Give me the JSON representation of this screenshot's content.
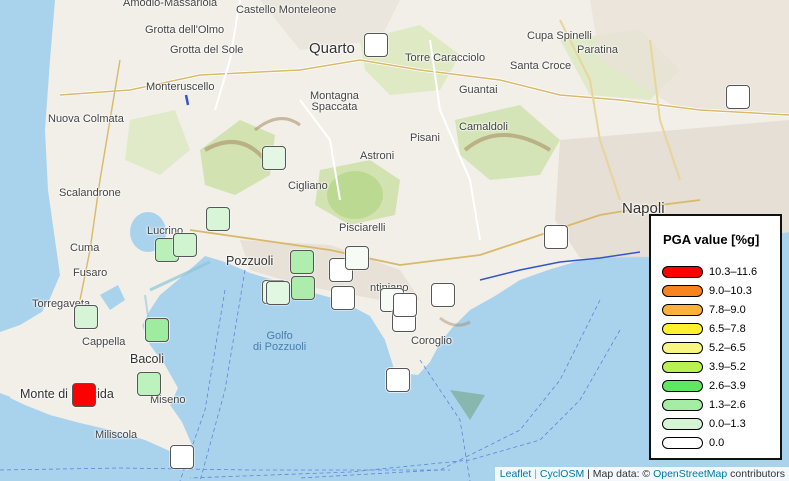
{
  "map": {
    "places": [
      {
        "id": "amodio",
        "label": "Amodio-Massariola"
      },
      {
        "id": "castello",
        "label": "Castello Monteleone"
      },
      {
        "id": "grotta-olmo",
        "label": "Grotta dell'Olmo"
      },
      {
        "id": "grotta-sole",
        "label": "Grotta del Sole"
      },
      {
        "id": "quarto",
        "label": "Quarto"
      },
      {
        "id": "torre-caracciolo",
        "label": "Torre Caracciolo"
      },
      {
        "id": "cupa-spinelli",
        "label": "Cupa Spinelli"
      },
      {
        "id": "paratina",
        "label": "Paratina"
      },
      {
        "id": "santa-croce",
        "label": "Santa Croce"
      },
      {
        "id": "monteruscello",
        "label": "Monteruscello"
      },
      {
        "id": "nuova-colmata",
        "label": "Nuova Colmata"
      },
      {
        "id": "guantai",
        "label": "Guantai"
      },
      {
        "id": "montagna-spaccata",
        "label": "Montagna\nSpaccata"
      },
      {
        "id": "camaldoli",
        "label": "Camaldoli"
      },
      {
        "id": "pisani",
        "label": "Pisani"
      },
      {
        "id": "astroni",
        "label": "Astroni"
      },
      {
        "id": "cigliano",
        "label": "Cigliano"
      },
      {
        "id": "scalandrone",
        "label": "Scalandrone"
      },
      {
        "id": "napoli",
        "label": "Napoli"
      },
      {
        "id": "lucrino",
        "label": "Lucrino"
      },
      {
        "id": "pisciarelli",
        "label": "Pisciarelli"
      },
      {
        "id": "cuma",
        "label": "Cuma"
      },
      {
        "id": "fusaro",
        "label": "Fusaro"
      },
      {
        "id": "pozzuoli",
        "label": "Pozzuoli"
      },
      {
        "id": "torregaveta",
        "label": "Torregaveta"
      },
      {
        "id": "cappella",
        "label": "Cappella"
      },
      {
        "id": "bacoli",
        "label": "Bacoli"
      },
      {
        "id": "coroglio",
        "label": "Coroglio"
      },
      {
        "id": "monte-procida",
        "label": "Monte di Procida"
      },
      {
        "id": "miseno",
        "label": "Miseno"
      },
      {
        "id": "miliscola",
        "label": "Miliscola"
      },
      {
        "id": "agnano",
        "label": "ntiniano"
      }
    ],
    "sea_label": "Golfo\ndi Pozzuoli"
  },
  "markers": [
    {
      "pga_class": "0.0",
      "color": "#ffffff"
    },
    {
      "pga_class": "0.0",
      "color": "#ffffff"
    },
    {
      "pga_class": "0.0–1.3",
      "color": "#e4f7e4"
    },
    {
      "pga_class": "0.0–1.3",
      "color": "#d8f5d8"
    },
    {
      "pga_class": "1.3–2.6",
      "color": "#b8f0b8"
    },
    {
      "pga_class": "0.0–1.3",
      "color": "#d0f3d0"
    },
    {
      "pga_class": "1.3–2.6",
      "color": "#b0eeb0"
    },
    {
      "pga_class": "1.3–2.6",
      "color": "#acedac"
    },
    {
      "pga_class": "0.0",
      "color": "#ffffff"
    },
    {
      "pga_class": "1.3–2.6",
      "color": "#b2efb2"
    },
    {
      "pga_class": "0.0",
      "color": "#ffffff"
    },
    {
      "pga_class": "0.0",
      "color": "#f6fbf6"
    },
    {
      "pga_class": "0.0–1.3",
      "color": "#e6f8e6"
    },
    {
      "pga_class": "0.0",
      "color": "#ffffff"
    },
    {
      "pga_class": "0.0–1.3",
      "color": "#e2f7e2"
    },
    {
      "pga_class": "1.3–2.6",
      "color": "#c4f2c4"
    },
    {
      "pga_class": "0.0",
      "color": "#f6fbf6"
    },
    {
      "pga_class": "0.0",
      "color": "#ffffff"
    },
    {
      "pga_class": "0.0",
      "color": "#ffffff"
    },
    {
      "pga_class": "0.0",
      "color": "#ffffff"
    },
    {
      "pga_class": "0.0",
      "color": "#ffffff"
    },
    {
      "pga_class": "0.0–1.3",
      "color": "#d6f4d6"
    },
    {
      "pga_class": "1.3–2.6",
      "color": "#9feb9f"
    },
    {
      "pga_class": "1.3–2.6",
      "color": "#bdf1bd"
    },
    {
      "pga_class": "0.0",
      "color": "#ffffff"
    },
    {
      "pga_class": "10.3–11.6",
      "color": "#ff0000"
    },
    {
      "pga_class": "0.0",
      "color": "#ffffff"
    }
  ],
  "legend": {
    "title": "PGA value [%g]",
    "items": [
      {
        "label": "10.3–11.6",
        "color": "#ff0000"
      },
      {
        "label": "9.0–10.3",
        "color": "#f7841f"
      },
      {
        "label": "7.8–9.0",
        "color": "#fbb13c"
      },
      {
        "label": "6.5–7.8",
        "color": "#fff12e"
      },
      {
        "label": "5.2–6.5",
        "color": "#f6f680"
      },
      {
        "label": "3.9–5.2",
        "color": "#b8f250"
      },
      {
        "label": "2.6–3.9",
        "color": "#5fe85f"
      },
      {
        "label": "1.3–2.6",
        "color": "#a5eda5"
      },
      {
        "label": "0.0–1.3",
        "color": "#d5f5d5"
      },
      {
        "label": "0.0",
        "color": "#ffffff"
      }
    ]
  },
  "attribution": {
    "leaflet": "Leaflet",
    "sep": "|",
    "cyclosm": "CyclOSM",
    "map_data": "| Map data: ©",
    "osm": "OpenStreetMap",
    "contributors": "contributors"
  }
}
